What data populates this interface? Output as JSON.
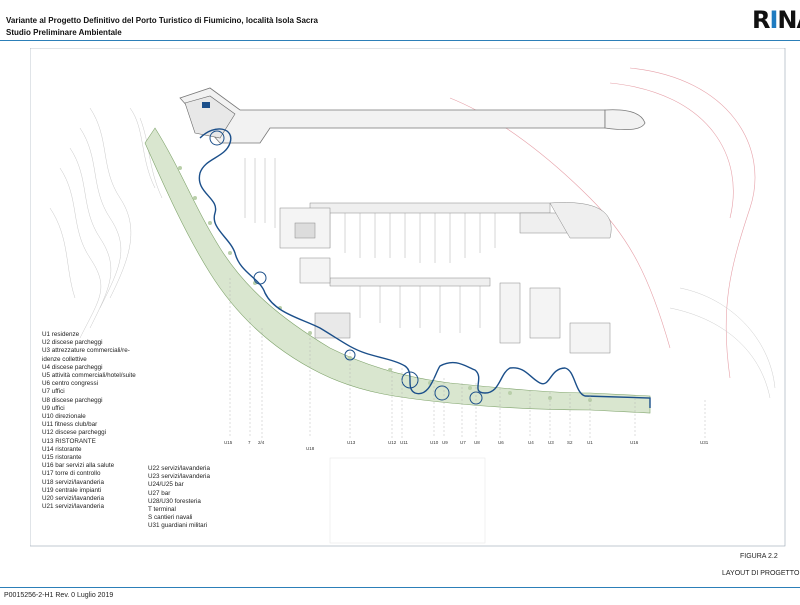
{
  "header": {
    "title": "Variante al Progetto Definitivo del Porto Turistico di Fiumicino, località Isola Sacra",
    "subtitle": "Studio Preliminare Ambientale",
    "logo_text": "RINA"
  },
  "colors": {
    "accent": "#2c7fb8",
    "path": "#1b4f8a",
    "green": "#7fa36b",
    "contour": "#e6a0a8"
  },
  "legend_left": [
    "U1 residenze",
    "U2 discese parcheggi",
    "U3 attrezzature commerciali/re-",
    "idenze collettive",
    "U4 discese parcheggi",
    "U5 attività commerciali/hotel/suite",
    "U6 centro congressi",
    "U7 uffici",
    "U8 discese parcheggi",
    "U9 uffici",
    "U10 direzionale",
    "U11 fitness club/bar",
    "U12 discese parcheggi",
    "U13 RISTORANTE",
    "U14 ristorante",
    "U15 ristorante",
    "U16 bar servizi alla salute",
    "U17 torre di controllo",
    "U18 servizi/lavanderia",
    "U19 centrale impianti",
    "U20 servizi/lavanderia",
    "U21 servizi/lavanderia"
  ],
  "legend_right": [
    "U22 servizi/lavanderia",
    "U23 servizi/lavanderia",
    "U24/U25 bar",
    "U27 bar",
    "U28/U30 foresteria",
    "T terminal",
    "S cantieri navali",
    "U31 guardiani militari"
  ],
  "section_labels": [
    "U15",
    "7",
    "2/4",
    "U18",
    "U13",
    "U12",
    "U11",
    "U10",
    "U9",
    "U7",
    "U8",
    "U6",
    "U4",
    "U3",
    "S2",
    "U1",
    "U16",
    "U31"
  ],
  "figure": {
    "number": "FIGURA 2.2",
    "title": "LAYOUT DI PROGETTO"
  },
  "footer": {
    "ref": "P0015256-2-H1 Rev. 0 Luglio 2019"
  }
}
